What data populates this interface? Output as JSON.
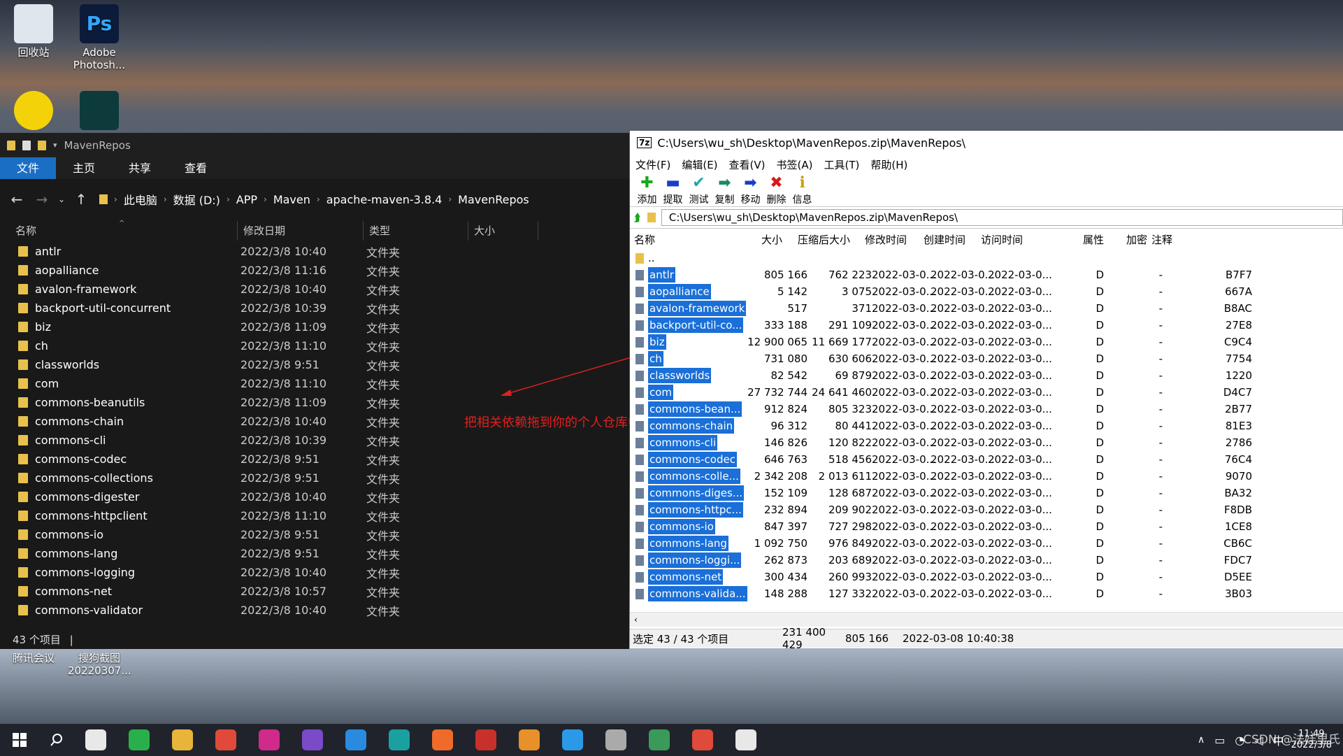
{
  "desktop": {
    "icons": [
      {
        "label": "回收站"
      },
      {
        "label": "Adobe Photosh..."
      },
      {
        "label": ""
      },
      {
        "label": ""
      },
      {
        "label": "腾讯会议"
      },
      {
        "label": "搜狗截图 20220307..."
      }
    ]
  },
  "explorer": {
    "title": "MavenRepos",
    "ribbon_tabs": [
      "文件",
      "主页",
      "共享",
      "查看"
    ],
    "breadcrumbs": [
      "此电脑",
      "数据 (D:)",
      "APP",
      "Maven",
      "apache-maven-3.8.4",
      "MavenRepos"
    ],
    "columns": [
      "名称",
      "修改日期",
      "类型",
      "大小"
    ],
    "rows": [
      {
        "name": "antlr",
        "date": "2022/3/8 10:40",
        "type": "文件夹"
      },
      {
        "name": "aopalliance",
        "date": "2022/3/8 11:16",
        "type": "文件夹"
      },
      {
        "name": "avalon-framework",
        "date": "2022/3/8 10:40",
        "type": "文件夹"
      },
      {
        "name": "backport-util-concurrent",
        "date": "2022/3/8 10:39",
        "type": "文件夹"
      },
      {
        "name": "biz",
        "date": "2022/3/8 11:09",
        "type": "文件夹"
      },
      {
        "name": "ch",
        "date": "2022/3/8 11:10",
        "type": "文件夹"
      },
      {
        "name": "classworlds",
        "date": "2022/3/8 9:51",
        "type": "文件夹"
      },
      {
        "name": "com",
        "date": "2022/3/8 11:10",
        "type": "文件夹"
      },
      {
        "name": "commons-beanutils",
        "date": "2022/3/8 11:09",
        "type": "文件夹"
      },
      {
        "name": "commons-chain",
        "date": "2022/3/8 10:40",
        "type": "文件夹"
      },
      {
        "name": "commons-cli",
        "date": "2022/3/8 10:39",
        "type": "文件夹"
      },
      {
        "name": "commons-codec",
        "date": "2022/3/8 9:51",
        "type": "文件夹"
      },
      {
        "name": "commons-collections",
        "date": "2022/3/8 9:51",
        "type": "文件夹"
      },
      {
        "name": "commons-digester",
        "date": "2022/3/8 10:40",
        "type": "文件夹"
      },
      {
        "name": "commons-httpclient",
        "date": "2022/3/8 11:10",
        "type": "文件夹"
      },
      {
        "name": "commons-io",
        "date": "2022/3/8 9:51",
        "type": "文件夹"
      },
      {
        "name": "commons-lang",
        "date": "2022/3/8 9:51",
        "type": "文件夹"
      },
      {
        "name": "commons-logging",
        "date": "2022/3/8 10:40",
        "type": "文件夹"
      },
      {
        "name": "commons-net",
        "date": "2022/3/8 10:57",
        "type": "文件夹"
      },
      {
        "name": "commons-validator",
        "date": "2022/3/8 10:40",
        "type": "文件夹"
      }
    ],
    "status": "43 个项目"
  },
  "annotation": {
    "text": "把相关依赖拖到你的个人仓库中",
    "color": "#e02020"
  },
  "zip": {
    "title": "C:\\Users\\wu_sh\\Desktop\\MavenRepos.zip\\MavenRepos\\",
    "menu": [
      "文件(F)",
      "编辑(E)",
      "查看(V)",
      "书签(A)",
      "工具(T)",
      "帮助(H)"
    ],
    "tools": [
      {
        "label": "添加",
        "glyph": "✚",
        "color": "#1aa81a"
      },
      {
        "label": "提取",
        "glyph": "▬",
        "color": "#1a3fc4"
      },
      {
        "label": "测试",
        "glyph": "✔",
        "color": "#1aa8a8"
      },
      {
        "label": "复制",
        "glyph": "➡",
        "color": "#1a8a6a"
      },
      {
        "label": "移动",
        "glyph": "➡",
        "color": "#1a3fc4"
      },
      {
        "label": "删除",
        "glyph": "✖",
        "color": "#d81a1a"
      },
      {
        "label": "信息",
        "glyph": "ℹ",
        "color": "#c8a010"
      }
    ],
    "path": "C:\\Users\\wu_sh\\Desktop\\MavenRepos.zip\\MavenRepos\\",
    "columns": [
      "名称",
      "大小",
      "压缩后大小",
      "修改时间",
      "创建时间",
      "访问时间",
      "属性",
      "加密",
      "注释"
    ],
    "parent": "..",
    "rows": [
      {
        "name": "antlr",
        "size": "805 166",
        "packed": "762 223",
        "mod": "2022-03-0...",
        "cre": "2022-03-0...",
        "acc": "2022-03-0...",
        "attr": "D",
        "enc": "-",
        "crc": "B7F7"
      },
      {
        "name": "aopalliance",
        "size": "5 142",
        "packed": "3 075",
        "mod": "2022-03-0...",
        "cre": "2022-03-0...",
        "acc": "2022-03-0...",
        "attr": "D",
        "enc": "-",
        "crc": "667A"
      },
      {
        "name": "avalon-framework",
        "size": "517",
        "packed": "371",
        "mod": "2022-03-0...",
        "cre": "2022-03-0...",
        "acc": "2022-03-0...",
        "attr": "D",
        "enc": "-",
        "crc": "B8AC"
      },
      {
        "name": "backport-util-co...",
        "size": "333 188",
        "packed": "291 109",
        "mod": "2022-03-0...",
        "cre": "2022-03-0...",
        "acc": "2022-03-0...",
        "attr": "D",
        "enc": "-",
        "crc": "27E8"
      },
      {
        "name": "biz",
        "size": "12 900 065",
        "packed": "11 669 177",
        "mod": "2022-03-0...",
        "cre": "2022-03-0...",
        "acc": "2022-03-0...",
        "attr": "D",
        "enc": "-",
        "crc": "C9C4"
      },
      {
        "name": "ch",
        "size": "731 080",
        "packed": "630 606",
        "mod": "2022-03-0...",
        "cre": "2022-03-0...",
        "acc": "2022-03-0...",
        "attr": "D",
        "enc": "-",
        "crc": "7754"
      },
      {
        "name": "classworlds",
        "size": "82 542",
        "packed": "69 879",
        "mod": "2022-03-0...",
        "cre": "2022-03-0...",
        "acc": "2022-03-0...",
        "attr": "D",
        "enc": "-",
        "crc": "1220"
      },
      {
        "name": "com",
        "size": "27 732 744",
        "packed": "24 641 460",
        "mod": "2022-03-0...",
        "cre": "2022-03-0...",
        "acc": "2022-03-0...",
        "attr": "D",
        "enc": "-",
        "crc": "D4C7"
      },
      {
        "name": "commons-bean...",
        "size": "912 824",
        "packed": "805 323",
        "mod": "2022-03-0...",
        "cre": "2022-03-0...",
        "acc": "2022-03-0...",
        "attr": "D",
        "enc": "-",
        "crc": "2B77"
      },
      {
        "name": "commons-chain",
        "size": "96 312",
        "packed": "80 441",
        "mod": "2022-03-0...",
        "cre": "2022-03-0...",
        "acc": "2022-03-0...",
        "attr": "D",
        "enc": "-",
        "crc": "81E3"
      },
      {
        "name": "commons-cli",
        "size": "146 826",
        "packed": "120 822",
        "mod": "2022-03-0...",
        "cre": "2022-03-0...",
        "acc": "2022-03-0...",
        "attr": "D",
        "enc": "-",
        "crc": "2786"
      },
      {
        "name": "commons-codec",
        "size": "646 763",
        "packed": "518 456",
        "mod": "2022-03-0...",
        "cre": "2022-03-0...",
        "acc": "2022-03-0...",
        "attr": "D",
        "enc": "-",
        "crc": "76C4"
      },
      {
        "name": "commons-colle...",
        "size": "2 342 208",
        "packed": "2 013 611",
        "mod": "2022-03-0...",
        "cre": "2022-03-0...",
        "acc": "2022-03-0...",
        "attr": "D",
        "enc": "-",
        "crc": "9070"
      },
      {
        "name": "commons-diges...",
        "size": "152 109",
        "packed": "128 687",
        "mod": "2022-03-0...",
        "cre": "2022-03-0...",
        "acc": "2022-03-0...",
        "attr": "D",
        "enc": "-",
        "crc": "BA32"
      },
      {
        "name": "commons-httpc...",
        "size": "232 894",
        "packed": "209 902",
        "mod": "2022-03-0...",
        "cre": "2022-03-0...",
        "acc": "2022-03-0...",
        "attr": "D",
        "enc": "-",
        "crc": "F8DB"
      },
      {
        "name": "commons-io",
        "size": "847 397",
        "packed": "727 298",
        "mod": "2022-03-0...",
        "cre": "2022-03-0...",
        "acc": "2022-03-0...",
        "attr": "D",
        "enc": "-",
        "crc": "1CE8"
      },
      {
        "name": "commons-lang",
        "size": "1 092 750",
        "packed": "976 849",
        "mod": "2022-03-0...",
        "cre": "2022-03-0...",
        "acc": "2022-03-0...",
        "attr": "D",
        "enc": "-",
        "crc": "CB6C"
      },
      {
        "name": "commons-loggi...",
        "size": "262 873",
        "packed": "203 689",
        "mod": "2022-03-0...",
        "cre": "2022-03-0...",
        "acc": "2022-03-0...",
        "attr": "D",
        "enc": "-",
        "crc": "FDC7"
      },
      {
        "name": "commons-net",
        "size": "300 434",
        "packed": "260 993",
        "mod": "2022-03-0...",
        "cre": "2022-03-0...",
        "acc": "2022-03-0...",
        "attr": "D",
        "enc": "-",
        "crc": "D5EE"
      },
      {
        "name": "commons-valida...",
        "size": "148 288",
        "packed": "127 332",
        "mod": "2022-03-0...",
        "cre": "2022-03-0...",
        "acc": "2022-03-0...",
        "attr": "D",
        "enc": "-",
        "crc": "3B03"
      }
    ],
    "status": {
      "selected": "选定 43 / 43 个项目",
      "size": "231 400 429",
      "packed": "805 166",
      "date": "2022-03-08 10:40:38"
    }
  },
  "taskbar": {
    "apps": [
      {
        "name": "sdk",
        "color": "#e8e8e8"
      },
      {
        "name": "wechat",
        "color": "#2ab04a"
      },
      {
        "name": "file-explorer",
        "color": "#e8b43a"
      },
      {
        "name": "chrome",
        "color": "#e04a3a"
      },
      {
        "name": "intellij",
        "color": "#d02a8a"
      },
      {
        "name": "visual-studio",
        "color": "#7a4ac8"
      },
      {
        "name": "vscode",
        "color": "#2a8ae0"
      },
      {
        "name": "arduino",
        "color": "#1aa0a0"
      },
      {
        "name": "postman",
        "color": "#f06a2a"
      },
      {
        "name": "app-red",
        "color": "#c8302a"
      },
      {
        "name": "app-orange",
        "color": "#e8902a"
      },
      {
        "name": "docker",
        "color": "#2a9ae8"
      },
      {
        "name": "app-gray",
        "color": "#aaaaaa"
      },
      {
        "name": "app-multi",
        "color": "#3a9a5a"
      },
      {
        "name": "chrome-2",
        "color": "#e04a3a"
      },
      {
        "name": "7zip",
        "color": "#e8e8e8"
      }
    ],
    "ime": "中",
    "time": "11:49",
    "date": "2022/3/8",
    "watermark": "CSDN @法娃里氏"
  }
}
